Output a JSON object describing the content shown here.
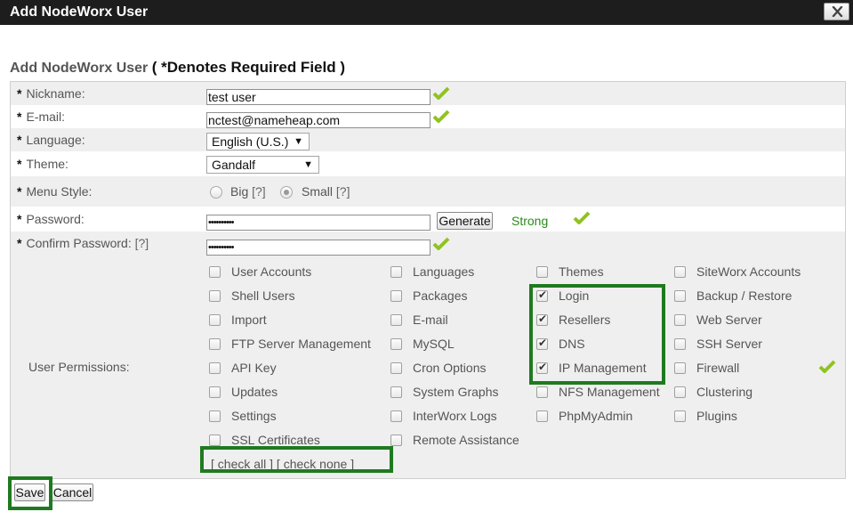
{
  "dialog": {
    "title": "Add NodeWorx User",
    "close_icon": "close-icon"
  },
  "heading": {
    "title": "Add NodeWorx User",
    "note": "( *Denotes Required Field )"
  },
  "form": {
    "required_mark": "*",
    "help_mark": "[?]",
    "nickname": {
      "label": "Nickname:",
      "value": "test user"
    },
    "email": {
      "label": "E-mail:",
      "value": "nctest@nameheap.com"
    },
    "language": {
      "label": "Language:",
      "value": "English (U.S.)"
    },
    "theme": {
      "label": "Theme:",
      "value": "Gandalf"
    },
    "menu_style": {
      "label": "Menu Style:",
      "options": [
        {
          "label": "Big",
          "selected": false
        },
        {
          "label": "Small",
          "selected": true
        }
      ]
    },
    "password": {
      "label": "Password:",
      "value": "••••••••••",
      "generate_label": "Generate",
      "strength": "Strong"
    },
    "confirm_password": {
      "label": "Confirm Password:",
      "value": "••••••••••"
    },
    "permissions": {
      "label": "User Permissions:",
      "col1": [
        {
          "label": "User Accounts",
          "checked": false
        },
        {
          "label": "Shell Users",
          "checked": false
        },
        {
          "label": "Import",
          "checked": false
        },
        {
          "label": "FTP Server Management",
          "checked": false
        },
        {
          "label": "API Key",
          "checked": false
        },
        {
          "label": "Updates",
          "checked": false
        },
        {
          "label": "Settings",
          "checked": false
        },
        {
          "label": "SSL Certificates",
          "checked": false
        }
      ],
      "col2": [
        {
          "label": "Languages",
          "checked": false
        },
        {
          "label": "Packages",
          "checked": false
        },
        {
          "label": "E-mail",
          "checked": false
        },
        {
          "label": "MySQL",
          "checked": false
        },
        {
          "label": "Cron Options",
          "checked": false
        },
        {
          "label": "System Graphs",
          "checked": false
        },
        {
          "label": "InterWorx Logs",
          "checked": false
        },
        {
          "label": "Remote Assistance",
          "checked": false
        }
      ],
      "col3": [
        {
          "label": "Themes",
          "checked": false
        },
        {
          "label": "Login",
          "checked": true
        },
        {
          "label": "Resellers",
          "checked": true
        },
        {
          "label": "DNS",
          "checked": true
        },
        {
          "label": "IP Management",
          "checked": true
        },
        {
          "label": "NFS Management",
          "checked": false
        },
        {
          "label": "PhpMyAdmin",
          "checked": false
        }
      ],
      "col4": [
        {
          "label": "SiteWorx Accounts",
          "checked": false
        },
        {
          "label": "Backup / Restore",
          "checked": false
        },
        {
          "label": "Web Server",
          "checked": false
        },
        {
          "label": "SSH Server",
          "checked": false
        },
        {
          "label": "Firewall",
          "checked": false
        },
        {
          "label": "Clustering",
          "checked": false
        },
        {
          "label": "Plugins",
          "checked": false
        }
      ],
      "check_all": "[ check all ]",
      "check_none": "[ check none ]"
    },
    "colors": {
      "valid_check": "#8fc31f",
      "highlight": "#1f7a1f",
      "strong": "#2a8a1a"
    }
  },
  "footer": {
    "save_label": "Save",
    "cancel_label": "Cancel"
  }
}
